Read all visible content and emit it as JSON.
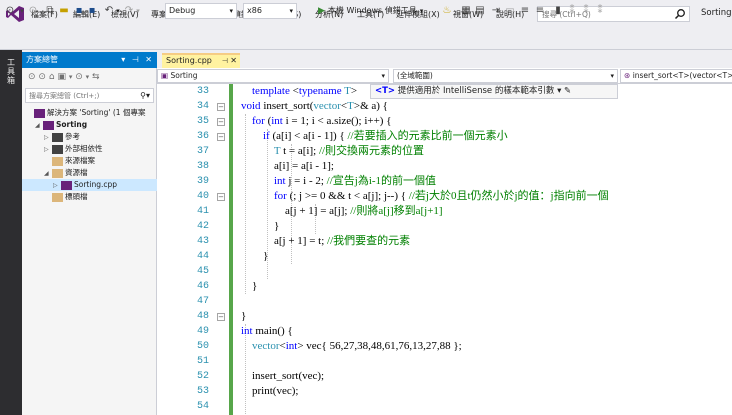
{
  "menu": [
    "檔案(F)",
    "編輯(E)",
    "檢視(V)",
    "專案(P)",
    "建置(B)",
    "偵錯(D)",
    "測試(S)",
    "分析(N)",
    "工具(T)",
    "延伸模組(X)",
    "視窗(W)",
    "說明(H)"
  ],
  "search": {
    "placeholder": "搜尋 (Ctrl+Q)"
  },
  "solution_name": "Sorting",
  "toolbar": {
    "config": "Debug",
    "platform": "x86",
    "run_label": "本機 Windows 偵錯工具"
  },
  "left_strip_label": "工具箱",
  "explorer": {
    "title": "方案總管",
    "search_placeholder": "搜尋方案總管 (Ctrl+;)",
    "tree": [
      {
        "label": "解決方案 'Sorting' (1 個專案",
        "indent": 0,
        "arrow": "",
        "icon": "solution-icon"
      },
      {
        "label": "Sorting",
        "indent": 1,
        "arrow": "◢",
        "icon": "project-icon",
        "bold": true
      },
      {
        "label": "參考",
        "indent": 2,
        "arrow": "▷",
        "icon": "references-icon"
      },
      {
        "label": "外部相依性",
        "indent": 2,
        "arrow": "▷",
        "icon": "external-deps-icon"
      },
      {
        "label": "來源檔案",
        "indent": 2,
        "arrow": "",
        "icon": "folder-icon"
      },
      {
        "label": "資源檔",
        "indent": 2,
        "arrow": "◢",
        "icon": "folder-icon"
      },
      {
        "label": "Sorting.cpp",
        "indent": 3,
        "arrow": "▷",
        "icon": "cpp-file-icon",
        "selected": true
      },
      {
        "label": "標頭檔",
        "indent": 2,
        "arrow": "",
        "icon": "folder-icon"
      }
    ]
  },
  "tab": {
    "label": "Sorting.cpp"
  },
  "nav": {
    "project": "Sorting",
    "scope": "(全域範圍)",
    "member": "insert_sort<T>(vector<T>"
  },
  "tooltip": {
    "param": "<T>",
    "text": " 提供適用於 IntelliSense 的樣本範本引數 ▾ ✎"
  },
  "code": {
    "line_numbers": [
      "33",
      "34",
      "35",
      "36",
      "37",
      "38",
      "39",
      "40",
      "41",
      "42",
      "43",
      "44",
      "45",
      "46",
      "47",
      "48",
      "49",
      "50",
      "51",
      "52",
      "53",
      "54"
    ]
  }
}
